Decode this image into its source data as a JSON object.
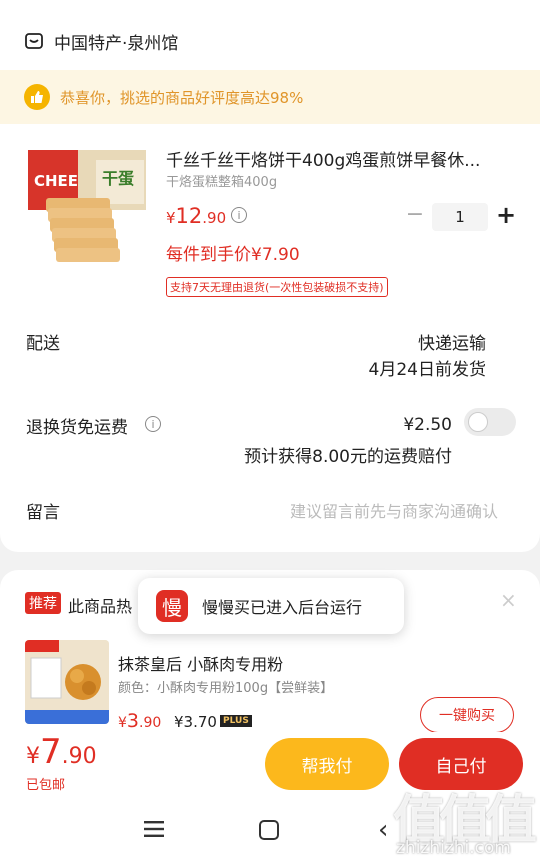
{
  "store": {
    "name": "中国特产·泉州馆",
    "icon": "store-icon"
  },
  "rating": {
    "text": "恭喜你，挑选的商品好评度高达98%",
    "icon": "thumbs-up-icon"
  },
  "product": {
    "title": "千丝千丝干烙饼干400g鸡蛋煎饼早餐休...",
    "spec": "干烙蛋糕整箱400g",
    "price_symbol": "¥",
    "price_int": "12",
    "price_dec": ".90",
    "quantity": "1",
    "deal_price": "每件到手价¥7.90",
    "return_policy": "支持7天无理由退货(一次性包装破损不支持)"
  },
  "delivery": {
    "label": "配送",
    "method": "快递运输",
    "ship_date": "4月24日前发货"
  },
  "return_insurance": {
    "label": "退换货免运费",
    "price": "¥2.50",
    "note": "预计获得8.00元的运费赔付"
  },
  "memo": {
    "label": "留言",
    "placeholder": "建议留言前先与商家沟通确认"
  },
  "recommend": {
    "tag": "推荐",
    "title": "此商品热",
    "close": "×",
    "item": {
      "name": "抹茶皇后 小酥肉专用粉",
      "spec": "颜色：小酥肉专用粉100g【尝鲜装】",
      "price_symbol": "¥",
      "price_int": "3",
      "price_dec": ".90",
      "plus_price": "¥3.70",
      "plus_badge": "PLUS",
      "buy_label": "一键购买"
    }
  },
  "toast": {
    "icon_char": "慢",
    "text": "慢慢买已进入后台运行"
  },
  "checkout": {
    "total_symbol": "¥",
    "total_int": "7",
    "total_dec": ".90",
    "shipping": "已包邮",
    "help_pay": "帮我付",
    "self_pay": "自己付"
  },
  "watermark": {
    "title": "值值值",
    "url": "zhizhizhi.com"
  },
  "colors": {
    "accent": "#e02e24",
    "gold": "#fcb81c",
    "rating_bg": "#fdf6e3"
  }
}
